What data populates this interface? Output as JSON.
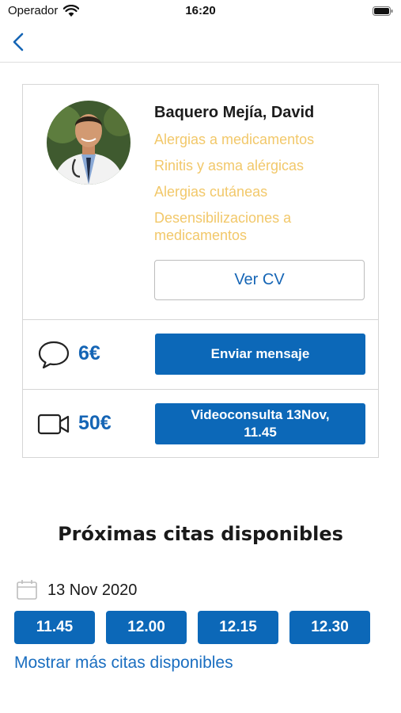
{
  "status_bar": {
    "carrier": "Operador",
    "time": "16:20"
  },
  "nav": {
    "back_icon": "chevron-left-icon"
  },
  "doctor": {
    "name": "Baquero Mejía, David",
    "specialties": [
      "Alergias a medicamentos",
      "Rinitis y asma alérgicas",
      "Alergias cutáneas",
      "Desensibilizaciones a medicamentos"
    ],
    "cv_button_label": "Ver CV"
  },
  "message": {
    "icon": "chat-bubble-icon",
    "price": "6€",
    "button_label": "Enviar mensaje"
  },
  "video": {
    "icon": "video-camera-icon",
    "price": "50€",
    "button_label": "Videoconsulta 13Nov, 11.45"
  },
  "availability": {
    "title": "Próximas citas disponibles",
    "date_icon": "calendar-icon",
    "date": "13 Nov 2020",
    "slots": [
      "11.45",
      "12.00",
      "12.15",
      "12.30"
    ],
    "more_link": "Mostrar más citas disponibles"
  },
  "colors": {
    "accent": "#0c68b8",
    "specialty": "#f2c86a",
    "price": "#1565b5"
  }
}
